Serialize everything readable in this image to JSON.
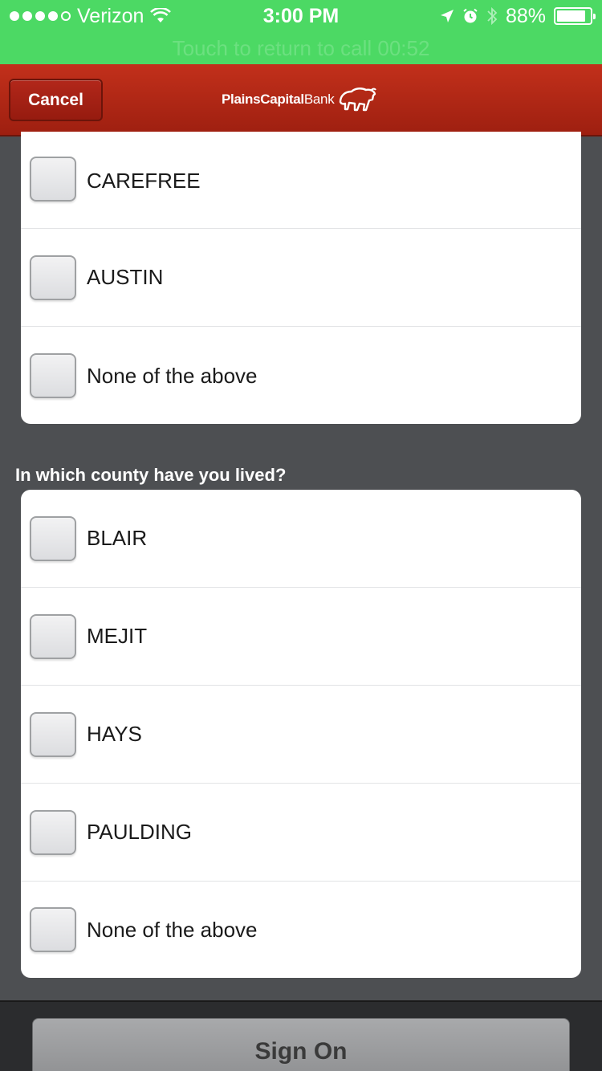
{
  "status_bar": {
    "signal_bars_filled": 4,
    "signal_bars_total": 5,
    "carrier": "Verizon",
    "time": "3:00 PM",
    "battery_percent": "88%",
    "battery_level": 0.88,
    "call_banner": "Touch to return to call 00:52"
  },
  "nav": {
    "cancel_label": "Cancel",
    "logo_bold": "PlainsCapital",
    "logo_light": "Bank"
  },
  "section1": {
    "options": [
      {
        "label": "CAREFREE"
      },
      {
        "label": "AUSTIN"
      },
      {
        "label": "None of the above"
      }
    ]
  },
  "section2": {
    "question": "In which county have you lived?",
    "options": [
      {
        "label": "BLAIR"
      },
      {
        "label": "MEJIT"
      },
      {
        "label": "HAYS"
      },
      {
        "label": "PAULDING"
      },
      {
        "label": "None of the above"
      }
    ]
  },
  "footer": {
    "sign_on_label": "Sign On"
  },
  "colors": {
    "status_green": "#4cd964",
    "nav_red": "#b02818",
    "background": "#4d4f52"
  }
}
